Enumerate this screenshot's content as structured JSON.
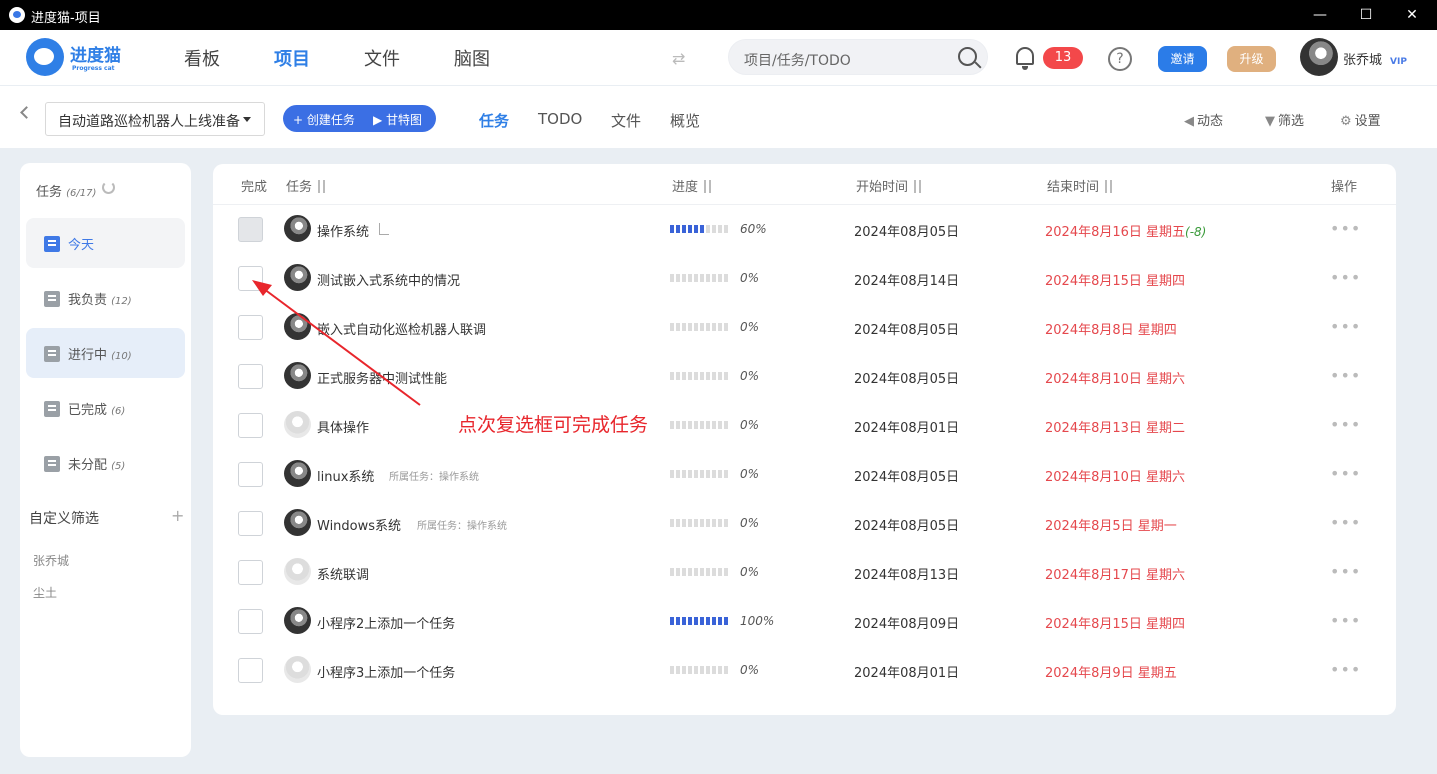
{
  "window": {
    "title": "进度猫-项目",
    "min": "—",
    "max": "☐",
    "close": "✕"
  },
  "header": {
    "logo_name": "进度猫",
    "logo_sub": "Progress cat",
    "nav": [
      {
        "label": "看板"
      },
      {
        "label": "项目"
      },
      {
        "label": "文件"
      },
      {
        "label": "脑图"
      }
    ],
    "search_placeholder": "项目/任务/TODO",
    "notifications": "13",
    "help": "?",
    "invite": "邀请",
    "upgrade": "升级",
    "user": "张乔城",
    "vip": "VIP"
  },
  "subbar": {
    "project": "自动道路巡检机器人上线准备",
    "create_task": "+ 创建任务",
    "gantt": "▶ 甘特图",
    "tabs": [
      {
        "label": "任务"
      },
      {
        "label": "TODO"
      },
      {
        "label": "文件"
      },
      {
        "label": "概览"
      }
    ],
    "activity": "动态",
    "filter": "筛选",
    "settings": "设置"
  },
  "sidebar": {
    "title": "任务",
    "count": "(6/17)",
    "items": [
      {
        "label": "今天",
        "count": ""
      },
      {
        "label": "我负责",
        "count": "(12)"
      },
      {
        "label": "进行中",
        "count": "(10)"
      },
      {
        "label": "已完成",
        "count": "(6)"
      },
      {
        "label": "未分配",
        "count": "(5)"
      }
    ],
    "custom_filter": "自定义筛选",
    "plus": "+",
    "people": [
      "张乔城",
      "尘土"
    ]
  },
  "table": {
    "headers": {
      "done": "完成",
      "task": "任务",
      "progress": "进度",
      "start": "开始时间",
      "end": "结束时间",
      "ops": "操作"
    },
    "rows": [
      {
        "name": "操作系统",
        "parent": "",
        "progress": 60,
        "pct": "60%",
        "start": "2024年08月05日",
        "end": "2024年8月16日 星期五",
        "extra": "(-8)",
        "avatar": "dark",
        "checkbox": "gray",
        "subtask": true
      },
      {
        "name": "测试嵌入式系统中的情况",
        "parent": "",
        "progress": 0,
        "pct": "0%",
        "start": "2024年08月14日",
        "end": "2024年8月15日 星期四",
        "extra": "",
        "avatar": "dark",
        "checkbox": "white",
        "subtask": false
      },
      {
        "name": "嵌入式自动化巡检机器人联调",
        "parent": "",
        "progress": 0,
        "pct": "0%",
        "start": "2024年08月05日",
        "end": "2024年8月8日 星期四",
        "extra": "",
        "avatar": "dark",
        "checkbox": "white",
        "subtask": false
      },
      {
        "name": "正式服务器中测试性能",
        "parent": "",
        "progress": 0,
        "pct": "0%",
        "start": "2024年08月05日",
        "end": "2024年8月10日 星期六",
        "extra": "",
        "avatar": "dark",
        "checkbox": "white",
        "subtask": false
      },
      {
        "name": "具体操作",
        "parent": "",
        "progress": 0,
        "pct": "0%",
        "start": "2024年08月01日",
        "end": "2024年8月13日 星期二",
        "extra": "",
        "avatar": "light",
        "checkbox": "white",
        "subtask": false
      },
      {
        "name": "linux系统",
        "parent": "所属任务：操作系统",
        "progress": 0,
        "pct": "0%",
        "start": "2024年08月05日",
        "end": "2024年8月10日 星期六",
        "extra": "",
        "avatar": "dark",
        "checkbox": "white",
        "subtask": false
      },
      {
        "name": "Windows系统",
        "parent": "所属任务：操作系统",
        "progress": 0,
        "pct": "0%",
        "start": "2024年08月05日",
        "end": "2024年8月5日 星期一",
        "extra": "",
        "avatar": "dark",
        "checkbox": "white",
        "subtask": false
      },
      {
        "name": "系统联调",
        "parent": "",
        "progress": 0,
        "pct": "0%",
        "start": "2024年08月13日",
        "end": "2024年8月17日 星期六",
        "extra": "",
        "avatar": "light",
        "checkbox": "white",
        "subtask": false
      },
      {
        "name": "小程序2上添加一个任务",
        "parent": "",
        "progress": 100,
        "pct": "100%",
        "start": "2024年08月09日",
        "end": "2024年8月15日 星期四",
        "extra": "",
        "avatar": "dark",
        "checkbox": "white",
        "subtask": false
      },
      {
        "name": "小程序3上添加一个任务",
        "parent": "",
        "progress": 0,
        "pct": "0%",
        "start": "2024年08月01日",
        "end": "2024年8月9日 星期五",
        "extra": "",
        "avatar": "light",
        "checkbox": "white",
        "subtask": false
      }
    ],
    "dots": "•••"
  },
  "annotation": {
    "text": "点次复选框可完成任务",
    "color": "#e8262c"
  },
  "colors": {
    "accent": "#2f7fe6",
    "danger": "#e5484d",
    "badge": "#f3484a",
    "upgrade": "#e0b07f"
  }
}
